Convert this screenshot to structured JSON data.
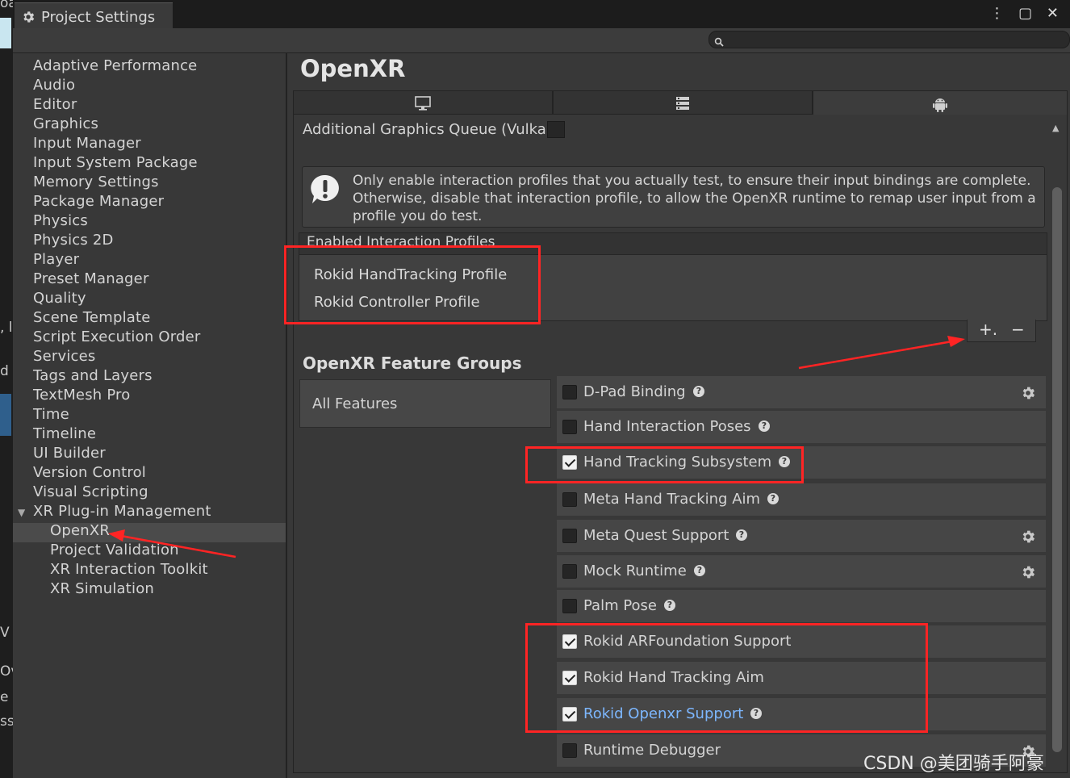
{
  "window": {
    "title": "Project Settings",
    "controls": "⋮ ▢ ✕"
  },
  "edge": {
    "t1": "oal",
    "t2": ", l",
    "t3": "d",
    "t4": "V",
    "t5": "Ov",
    "t6": "e",
    "t7": "ssi"
  },
  "search": {
    "placeholder": ""
  },
  "sidebar": {
    "items": [
      "Adaptive Performance",
      "Audio",
      "Editor",
      "Graphics",
      "Input Manager",
      "Input System Package",
      "Memory Settings",
      "Package Manager",
      "Physics",
      "Physics 2D",
      "Player",
      "Preset Manager",
      "Quality",
      "Scene Template",
      "Script Execution Order",
      "Services",
      "Tags and Layers",
      "TextMesh Pro",
      "Time",
      "Timeline",
      "UI Builder",
      "Version Control",
      "Visual Scripting",
      "XR Plug-in Management"
    ],
    "sub_items": [
      "OpenXR",
      "Project Validation",
      "XR Interaction Toolkit",
      "XR Simulation"
    ],
    "selected": "OpenXR"
  },
  "main": {
    "title": "OpenXR",
    "platform_tabs": [
      "desktop-icon",
      "server-icon",
      "android-icon"
    ],
    "active_tab": 2,
    "additional_queue_label": "Additional Graphics Queue (Vulkai",
    "help_text": "Only enable interaction profiles that you actually test, to ensure their input bindings are complete. Otherwise, disable that interaction profile, to allow the OpenXR runtime to remap user input from a profile you do test.",
    "profiles_header": "Enabled Interaction Profiles",
    "profiles": [
      "Rokid HandTracking Profile",
      "Rokid Controller Profile"
    ],
    "add_label": "+.",
    "remove_label": "−",
    "feature_groups_title": "OpenXR Feature Groups",
    "feature_group_all": "All Features",
    "features": [
      {
        "label": "D-Pad Binding",
        "checked": false,
        "help": true,
        "gear": true,
        "link": false
      },
      {
        "label": "Hand Interaction Poses",
        "checked": false,
        "help": true,
        "gear": false,
        "link": false
      },
      {
        "label": "Hand Tracking Subsystem",
        "checked": true,
        "help": true,
        "gear": false,
        "link": false
      },
      {
        "label": "Meta Hand Tracking Aim",
        "checked": false,
        "help": true,
        "gear": false,
        "link": false
      },
      {
        "label": "Meta Quest Support",
        "checked": false,
        "help": true,
        "gear": true,
        "link": false
      },
      {
        "label": "Mock Runtime",
        "checked": false,
        "help": true,
        "gear": true,
        "link": false
      },
      {
        "label": "Palm Pose",
        "checked": false,
        "help": true,
        "gear": false,
        "link": false
      },
      {
        "label": "Rokid ARFoundation Support",
        "checked": true,
        "help": false,
        "gear": false,
        "link": false
      },
      {
        "label": "Rokid Hand Tracking Aim",
        "checked": true,
        "help": false,
        "gear": false,
        "link": false
      },
      {
        "label": "Rokid Openxr Support",
        "checked": true,
        "help": true,
        "gear": false,
        "link": true
      },
      {
        "label": "Runtime Debugger",
        "checked": false,
        "help": false,
        "gear": true,
        "link": false
      }
    ]
  },
  "colors": {
    "annotation": "#ff2424",
    "link": "#7db7ff"
  },
  "watermark": "CSDN @美团骑手阿豪"
}
